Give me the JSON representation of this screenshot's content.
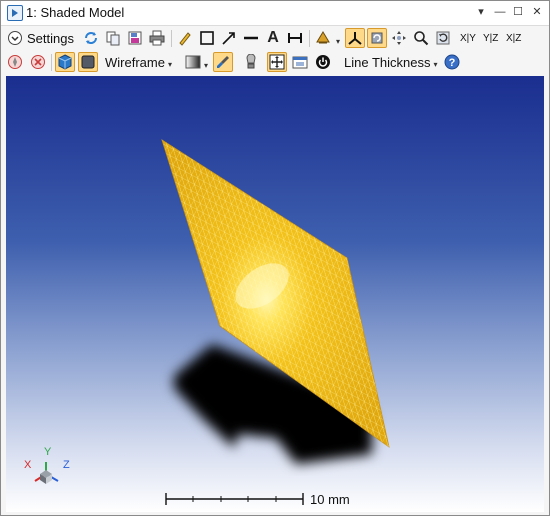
{
  "window": {
    "title": "1: Shaded Model"
  },
  "toolbar1": {
    "settings_label": "Settings",
    "axis_xy": "X|Y",
    "axis_yz": "Y|Z",
    "axis_xz": "X|Z"
  },
  "toolbar2": {
    "render_mode": "Wireframe",
    "line_thickness": "Line Thickness"
  },
  "viewport": {
    "scale_label": "10 mm",
    "triad": {
      "x": "X",
      "y": "Y",
      "z": "Z"
    }
  },
  "colors": {
    "surface": "#f2c21a",
    "surface_highlight": "#fff38a",
    "shadow": "#000000",
    "background_top": "#1a2e8f",
    "background_bottom": "#ffffff",
    "active_button": "#ffd98a"
  }
}
